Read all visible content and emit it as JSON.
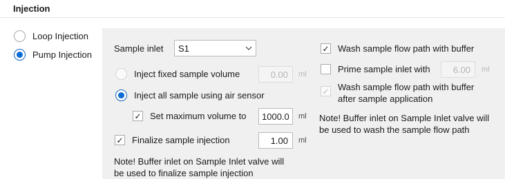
{
  "section": {
    "title": "Injection"
  },
  "mode": {
    "loop_label": "Loop Injection",
    "pump_label": "Pump Injection",
    "selected": "pump"
  },
  "sample_inlet": {
    "label": "Sample inlet",
    "value": "S1"
  },
  "inject_fixed": {
    "label": "Inject fixed sample volume",
    "value": "0.00",
    "unit": "ml",
    "checked": false,
    "enabled": false
  },
  "inject_all": {
    "label": "Inject all sample using air sensor",
    "checked": true
  },
  "max_volume": {
    "label": "Set maximum volume to",
    "value": "1000.0",
    "unit": "ml",
    "checked": true
  },
  "finalize": {
    "label": "Finalize sample injection",
    "value": "1.00",
    "unit": "ml",
    "checked": true
  },
  "note_left": {
    "line1": "Note! Buffer inlet on Sample Inlet valve will",
    "line2": "be used to finalize sample injection"
  },
  "wash_flow": {
    "label": "Wash sample flow path with buffer",
    "checked": true
  },
  "prime_inlet": {
    "label": "Prime sample inlet with",
    "value": "6.00",
    "unit": "ml",
    "checked": false,
    "enabled": false
  },
  "wash_after": {
    "line1": "Wash sample flow path with buffer",
    "line2": "after sample application",
    "checked": true,
    "enabled": false
  },
  "note_right": {
    "line1": "Note! Buffer inlet on Sample Inlet valve will",
    "line2": "be used to wash the sample flow path"
  },
  "icons": {
    "check": "check-icon",
    "dropdown": "chevron-down-icon"
  },
  "colors": {
    "accent": "#0a6cd6",
    "panel": "#f0f0f0"
  }
}
